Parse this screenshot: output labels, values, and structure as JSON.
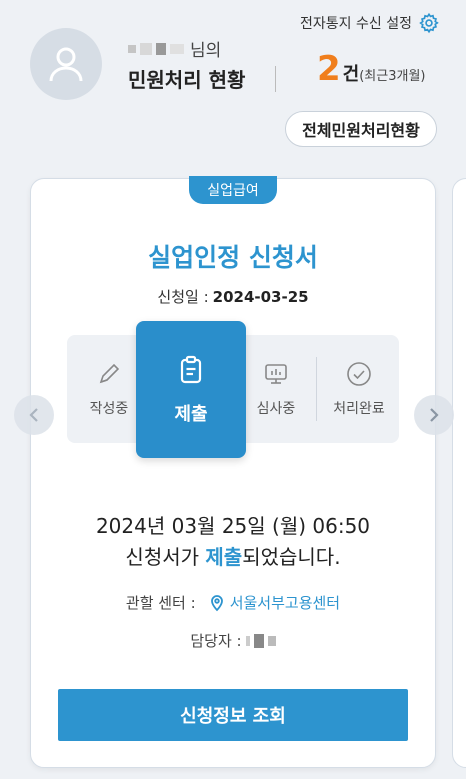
{
  "header": {
    "notify_link": "전자통지 수신 설정",
    "name_suffix": "님의",
    "status_title": "민원처리 현황",
    "count_num": "2",
    "count_unit": "건",
    "count_period": "(최근3개월)",
    "all_button": "전체민원처리현황"
  },
  "card": {
    "badge": "실업급여",
    "title": "실업인정 신청서",
    "apply_date_label": "신청일 :",
    "apply_date_value": "2024-03-25",
    "steps": [
      {
        "label": "작성중",
        "icon": "pencil-icon"
      },
      {
        "label": "제출",
        "icon": "clipboard-icon",
        "active": true
      },
      {
        "label": "심사중",
        "icon": "monitor-chart-icon"
      },
      {
        "label": "처리완료",
        "icon": "check-circle-icon"
      }
    ],
    "msg_line1": "2024년 03월 25일 (월) 06:50",
    "msg_line2_pre": "신청서가 ",
    "msg_line2_highlight": "제출",
    "msg_line2_post": "되었습니다.",
    "center_label": "관할 센터 :",
    "center_value": "서울서부고용센터",
    "manager_label": "담당자 :",
    "main_button": "신청정보 조회"
  },
  "colors": {
    "accent": "#2d94cf",
    "count": "#f07e1c",
    "background": "#eef1f5"
  }
}
